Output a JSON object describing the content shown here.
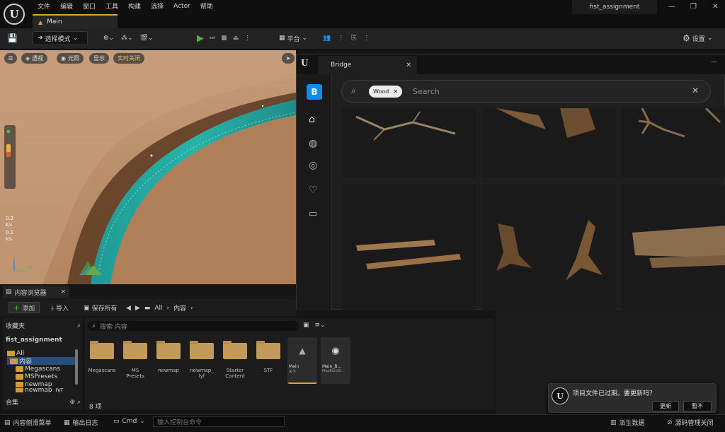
{
  "menu": [
    "文件",
    "编辑",
    "窗口",
    "工具",
    "构建",
    "选择",
    "Actor",
    "帮助"
  ],
  "project_name": "fist_assignment",
  "doc_tab": "Main",
  "toolbar": {
    "mode": "选择模式",
    "platform": "平台",
    "settings": "设置"
  },
  "viewport": {
    "buttons": [
      "透视",
      "光照",
      "显示",
      "实时关闭"
    ],
    "speed_readouts": [
      {
        "value": "0.2",
        "unit": "K/s"
      },
      {
        "value": "0.1",
        "unit": "K/s"
      }
    ],
    "axis_label": "Y"
  },
  "bridge": {
    "tab": "Bridge",
    "chip": "Wood",
    "search_placeholder": "Search"
  },
  "content_browser": {
    "tab": "内容浏览器",
    "add": "添加",
    "import": "导入",
    "save_all": "保存所有",
    "path": [
      "All",
      "内容"
    ],
    "favorites": "收藏夹",
    "project_root": "fist_assignment",
    "tree": [
      "All",
      "内容",
      "Megascans",
      "MSPresets",
      "newmap",
      "newmap_lyf"
    ],
    "collections": "合集",
    "search_placeholder": "搜索 内容",
    "folders": [
      {
        "label": "Megascans"
      },
      {
        "label": "MS\nPresets"
      },
      {
        "label": "newmap"
      },
      {
        "label": "newmap_\nlyf"
      },
      {
        "label": "Starter\nContent"
      },
      {
        "label": "STF"
      }
    ],
    "assets": [
      {
        "name": "Main",
        "sub": "关卡"
      },
      {
        "name": "Main_B...",
        "sub": "MapBuildD..."
      }
    ],
    "item_count": "8 项"
  },
  "statusbar": {
    "drawer": "内容侧滑菜单",
    "output_log": "输出日志",
    "cmd": "Cmd",
    "cmd_placeholder": "输入控制台命令",
    "derived_data": "派生数据",
    "source_control": "源码管理关闭"
  },
  "notification": {
    "text": "项目文件已过期。要更新吗？",
    "update": "更新",
    "later": "暂不"
  }
}
